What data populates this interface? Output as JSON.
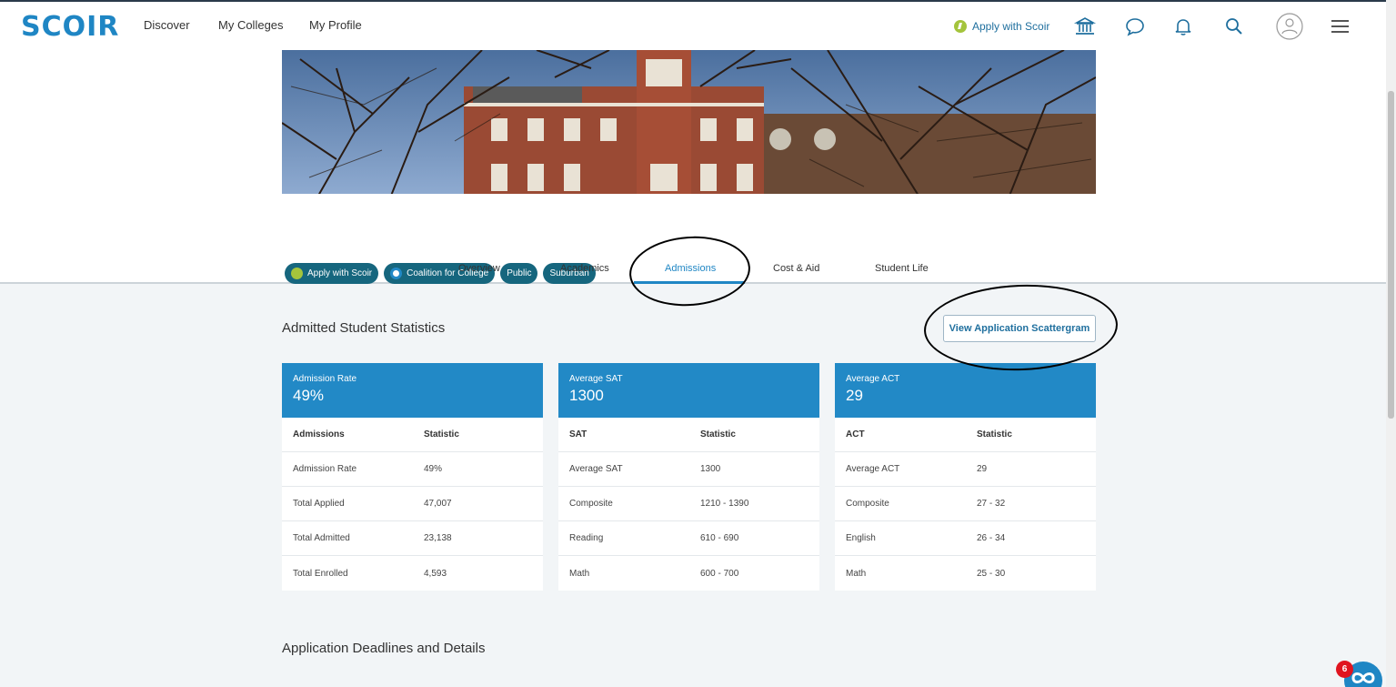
{
  "nav": {
    "logo": "SCOIR",
    "links": [
      "Discover",
      "My Colleges",
      "My Profile"
    ],
    "apply_label": "Apply with Scoir"
  },
  "tags": [
    "Apply with Scoir",
    "Coalition for College",
    "Public",
    "Suburban"
  ],
  "tabs": [
    "Overview",
    "Academics",
    "Admissions",
    "Cost & Aid",
    "Student Life"
  ],
  "active_tab": "Admissions",
  "stats": {
    "title": "Admitted Student Statistics",
    "scatter_button": "View Application Scattergram",
    "cards": [
      {
        "head_label": "Admission Rate",
        "head_value": "49%",
        "col1": "Admissions",
        "col2": "Statistic",
        "rows": [
          [
            "Admission Rate",
            "49%"
          ],
          [
            "Total Applied",
            "47,007"
          ],
          [
            "Total Admitted",
            "23,138"
          ],
          [
            "Total Enrolled",
            "4,593"
          ]
        ]
      },
      {
        "head_label": "Average SAT",
        "head_value": "1300",
        "col1": "SAT",
        "col2": "Statistic",
        "rows": [
          [
            "Average SAT",
            "1300"
          ],
          [
            "Composite",
            "1210 - 1390"
          ],
          [
            "Reading",
            "610 - 690"
          ],
          [
            "Math",
            "600 - 700"
          ]
        ]
      },
      {
        "head_label": "Average ACT",
        "head_value": "29",
        "col1": "ACT",
        "col2": "Statistic",
        "rows": [
          [
            "Average ACT",
            "29"
          ],
          [
            "Composite",
            "27 - 32"
          ],
          [
            "English",
            "26 - 34"
          ],
          [
            "Math",
            "25 - 30"
          ]
        ]
      }
    ]
  },
  "deadlines_title": "Application Deadlines and Details",
  "notification_count": "6",
  "colors": {
    "accent": "#2289c6",
    "tag": "#16667e",
    "brand_green": "#a4c43c"
  }
}
